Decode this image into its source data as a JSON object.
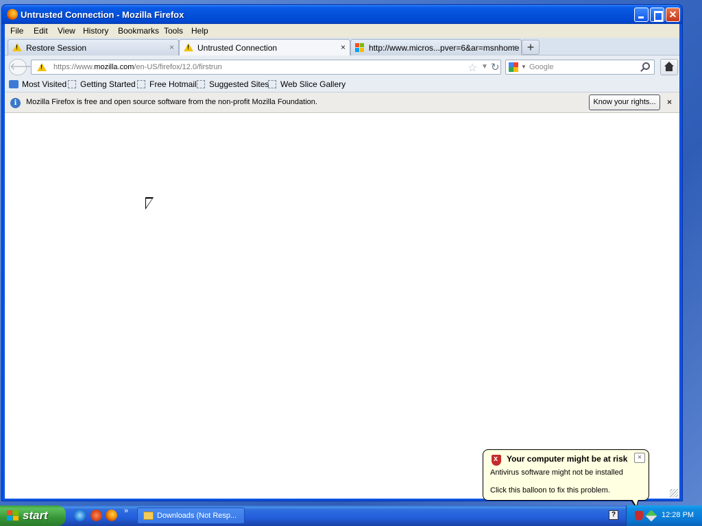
{
  "window": {
    "title": "Untrusted Connection - Mozilla Firefox"
  },
  "menu": [
    "File",
    "Edit",
    "View",
    "History",
    "Bookmarks",
    "Tools",
    "Help"
  ],
  "tabs": [
    {
      "label": "Restore Session",
      "icon": "warning-icon",
      "close": "×"
    },
    {
      "label": "Untrusted Connection",
      "icon": "warning-icon",
      "close": "×"
    },
    {
      "label": "http://www.micros...pver=6&ar=msnhome",
      "icon": "microsoft-icon",
      "close": "×"
    }
  ],
  "newtab_label": "+",
  "navbar": {
    "url_prefix": "https://www.",
    "url_domain": "mozilla.com",
    "url_path": "/en-US/firefox/12.0/firstrun",
    "search_placeholder": "Google"
  },
  "bookmarks": [
    "Most Visited",
    "Getting Started",
    "Free Hotmail",
    "Suggested Sites",
    "Web Slice Gallery"
  ],
  "notification": {
    "text": "Mozilla Firefox is free and open source software from the non-profit Mozilla Foundation.",
    "button": "Know your rights...",
    "close": "×"
  },
  "balloon": {
    "title": "Your computer might be at risk",
    "line1": "Antivirus software might not be installed",
    "line2": "Click this balloon to fix this problem.",
    "close": "×"
  },
  "taskbar": {
    "start_label": "start",
    "task_label": "Downloads (Not Resp...",
    "quicklaunch_more": "»",
    "clock": "12:28 PM",
    "help": "?"
  },
  "colors": {
    "titlebar": "#0451d9",
    "taskbar": "#245edb",
    "start": "#379637",
    "balloon_bg": "#ffffe1",
    "warning": "#f1c40f"
  }
}
